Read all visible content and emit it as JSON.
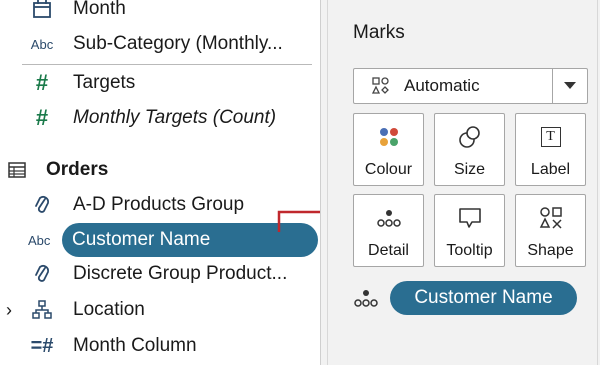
{
  "fields": {
    "month": "Month",
    "sub_category": "Sub-Category (Monthly...",
    "targets": "Targets",
    "monthly_targets": "Monthly Targets (Count)",
    "orders_header": "Orders",
    "ad_products": "A-D Products Group",
    "customer_name": "Customer Name",
    "discrete_group": "Discrete Group Product...",
    "location": "Location",
    "month_column": "Month Column"
  },
  "type_labels": {
    "abc": "Abc",
    "hash": "#",
    "hash_discrete": "=#"
  },
  "marks": {
    "title": "Marks",
    "mark_type": "Automatic",
    "tiles": [
      "Colour",
      "Size",
      "Label",
      "Detail",
      "Tooltip",
      "Shape"
    ],
    "label_glyph": "T",
    "detail_pill": "Customer Name"
  },
  "colors": {
    "pill": "#2a6e91",
    "arrow": "#c0282d",
    "measure": "#1a7a4a"
  }
}
